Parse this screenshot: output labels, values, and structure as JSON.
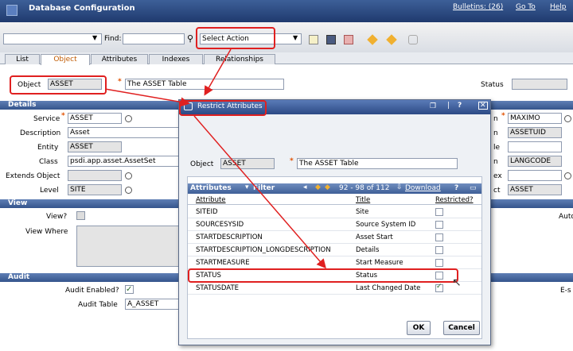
{
  "header": {
    "title": "Database Configuration",
    "bulletins": "Bulletins: (26)",
    "goto": "Go To",
    "help": "Help"
  },
  "toolbar": {
    "find_label": "Find:",
    "select_action": "Select Action"
  },
  "tabs": [
    {
      "label": "List"
    },
    {
      "label": "Object"
    },
    {
      "label": "Attributes"
    },
    {
      "label": "Indexes"
    },
    {
      "label": "Relationships"
    }
  ],
  "object_row": {
    "object_label": "Object",
    "object_value": "ASSET",
    "description": "The ASSET Table",
    "status_label": "Status",
    "status_value": ""
  },
  "details": {
    "section": "Details",
    "service_label": "Service",
    "service": "ASSET",
    "description_label": "Description",
    "description": "Asset",
    "entity_label": "Entity",
    "entity": "ASSET",
    "class_label": "Class",
    "class": "psdi.app.asset.AssetSet",
    "extends_label": "Extends Object",
    "extends": "",
    "level_label": "Level",
    "level": "SITE"
  },
  "right_fields": [
    {
      "label": "n",
      "value": "MAXIMO"
    },
    {
      "label": "n",
      "value": "ASSETUID"
    },
    {
      "label": "le",
      "value": ""
    },
    {
      "label": "n",
      "value": "LANGCODE"
    },
    {
      "label": "ex",
      "value": ""
    },
    {
      "label": "ct",
      "value": "ASSET"
    }
  ],
  "view": {
    "section": "View",
    "view_label": "View?",
    "where_label": "View Where",
    "right_cut": "Auto"
  },
  "audit": {
    "section": "Audit",
    "enabled_label": "Audit Enabled?",
    "table_label": "Audit Table",
    "table_value": "A_ASSET",
    "right_cut": "E-s"
  },
  "dialog": {
    "title": "Restrict Attributes",
    "object_label": "Object",
    "object_value": "ASSET",
    "object_desc": "The ASSET Table",
    "table_title": "Attributes",
    "filter": "Filter",
    "pager": "92 - 98 of 112",
    "download": "Download",
    "col_attribute": "Attribute",
    "col_title": "Title",
    "col_restricted": "Restricted?",
    "rows": [
      {
        "attribute": "SITEID",
        "title": "Site",
        "restricted": false
      },
      {
        "attribute": "SOURCESYSID",
        "title": "Source System ID",
        "restricted": false
      },
      {
        "attribute": "STARTDESCRIPTION",
        "title": "Asset Start",
        "restricted": false
      },
      {
        "attribute": "STARTDESCRIPTION_LONGDESCRIPTION",
        "title": "Details",
        "restricted": false
      },
      {
        "attribute": "STARTMEASURE",
        "title": "Start Measure",
        "restricted": false
      },
      {
        "attribute": "STATUS",
        "title": "Status",
        "restricted": false
      },
      {
        "attribute": "STATUSDATE",
        "title": "Last Changed Date",
        "restricted": true
      }
    ],
    "ok": "OK",
    "cancel": "Cancel"
  },
  "colors": {
    "header": "#2c4a85",
    "accent_red": "#e02020",
    "active_tab": "#c05a00"
  }
}
